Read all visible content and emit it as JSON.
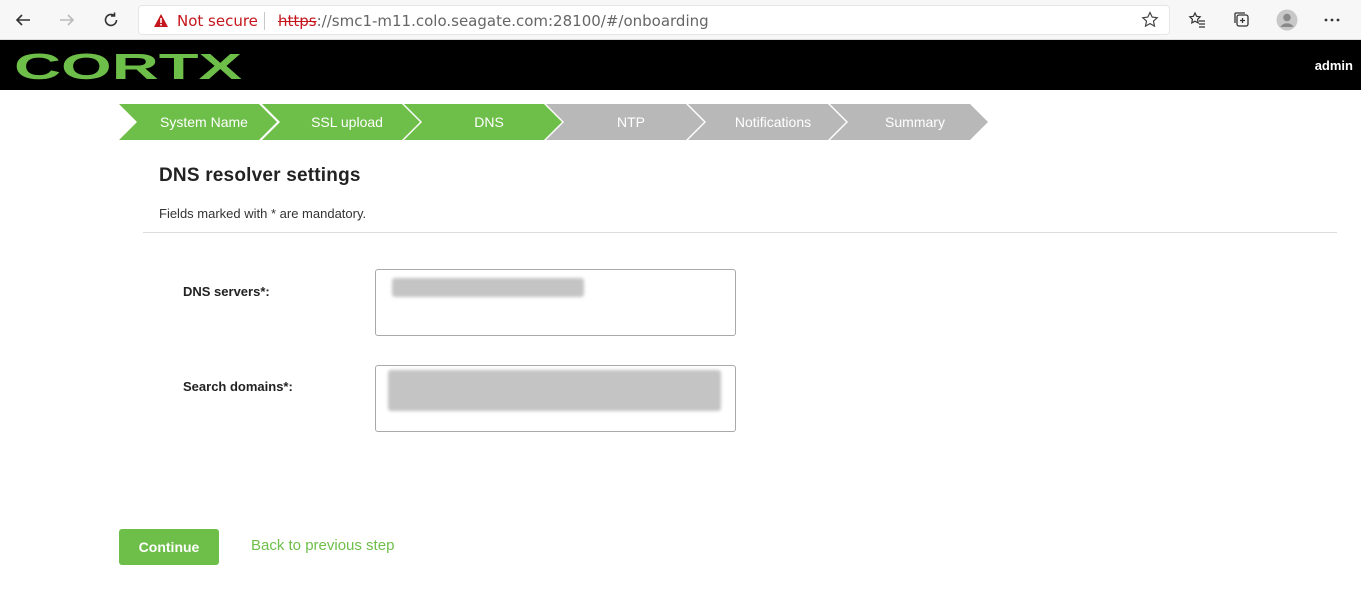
{
  "browser": {
    "security_label": "Not secure",
    "url_protocol": "https",
    "url_rest": "://smc1-m11.colo.seagate.com:28100/#/onboarding",
    "icons": [
      "back-arrow-icon",
      "forward-arrow-icon",
      "refresh-icon",
      "warning-icon",
      "star-icon",
      "favorites-icon",
      "collections-icon",
      "profile-icon",
      "more-icon"
    ]
  },
  "header": {
    "logo_text": "CORTX",
    "user": "admin",
    "brand_color": "#6ebe4a"
  },
  "stepper": {
    "steps": [
      {
        "label": "System Name",
        "status": "done"
      },
      {
        "label": "SSL upload",
        "status": "done"
      },
      {
        "label": "DNS",
        "status": "current"
      },
      {
        "label": "NTP",
        "status": "todo"
      },
      {
        "label": "Notifications",
        "status": "todo"
      },
      {
        "label": "Summary",
        "status": "todo"
      }
    ]
  },
  "page": {
    "title": "DNS resolver settings",
    "subtitle": "Fields marked with * are mandatory."
  },
  "form": {
    "dns_label": "DNS servers*:",
    "search_label": "Search domains*:"
  },
  "actions": {
    "continue_label": "Continue",
    "back_label": "Back to previous step"
  }
}
